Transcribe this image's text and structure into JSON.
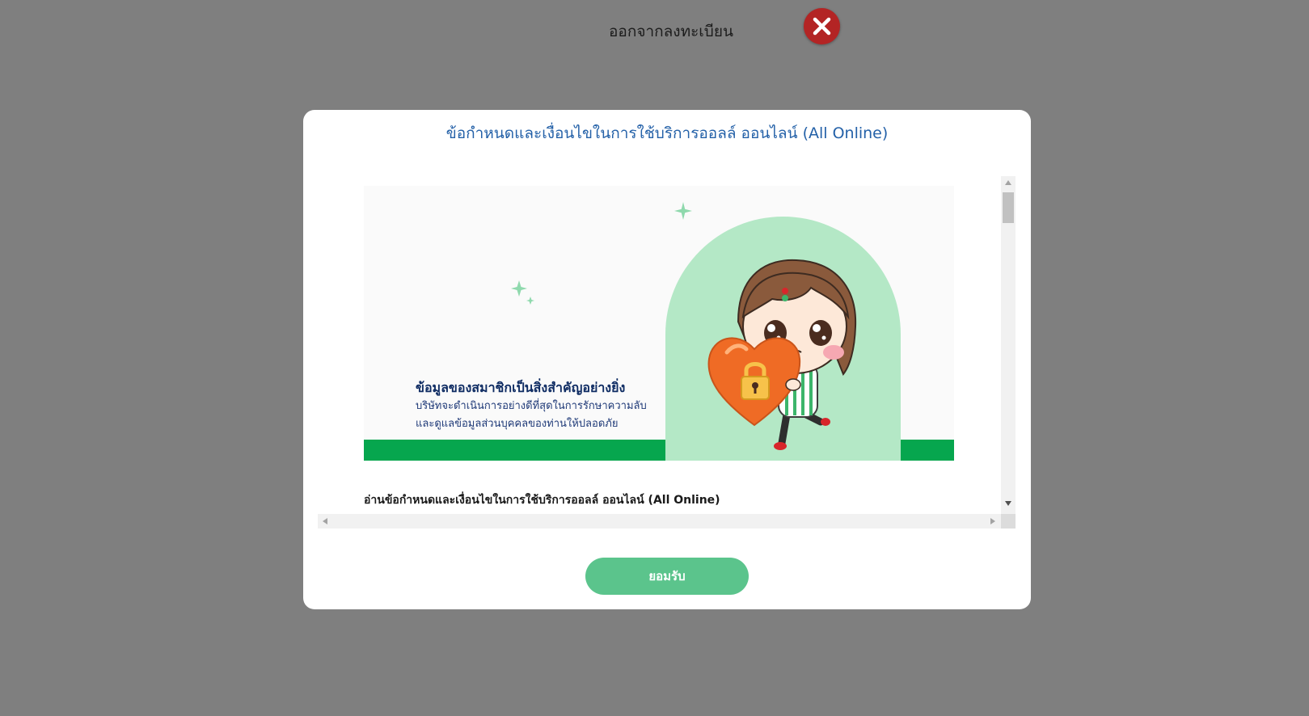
{
  "page": {
    "exit_label": "ออกจากลงทะเบียน",
    "close_icon": "close-x-icon"
  },
  "modal": {
    "title": "ข้อกำหนดและเงื่อนไขในการใช้บริการออลล์ ออนไลน์ (All Online)",
    "banner": {
      "heading": "ข้อมูลของสมาชิกเป็นสิ่งสำคัญอย่างยิ่ง",
      "sub_line1": "บริษัทจะดำเนินการอย่างดีที่สุดในการรักษาความลับ",
      "sub_line2": "และดูแลข้อมูลส่วนบุคคลของท่านให้ปลอดภัย",
      "illustration": "girl-holding-heart-lock-illustration"
    },
    "terms_heading": "อ่านข้อกำหนดและเงื่อนไขในการใช้บริการออลล์ ออนไลน์ (All Online)",
    "accept_label": "ยอมรับ"
  },
  "colors": {
    "overlay": "#7f7f7f",
    "title": "#2461a8",
    "accept_button": "#5bc48c",
    "banner_green": "#06a64e",
    "banner_arch": "#b4e8c6",
    "close_button": "#b32424"
  }
}
